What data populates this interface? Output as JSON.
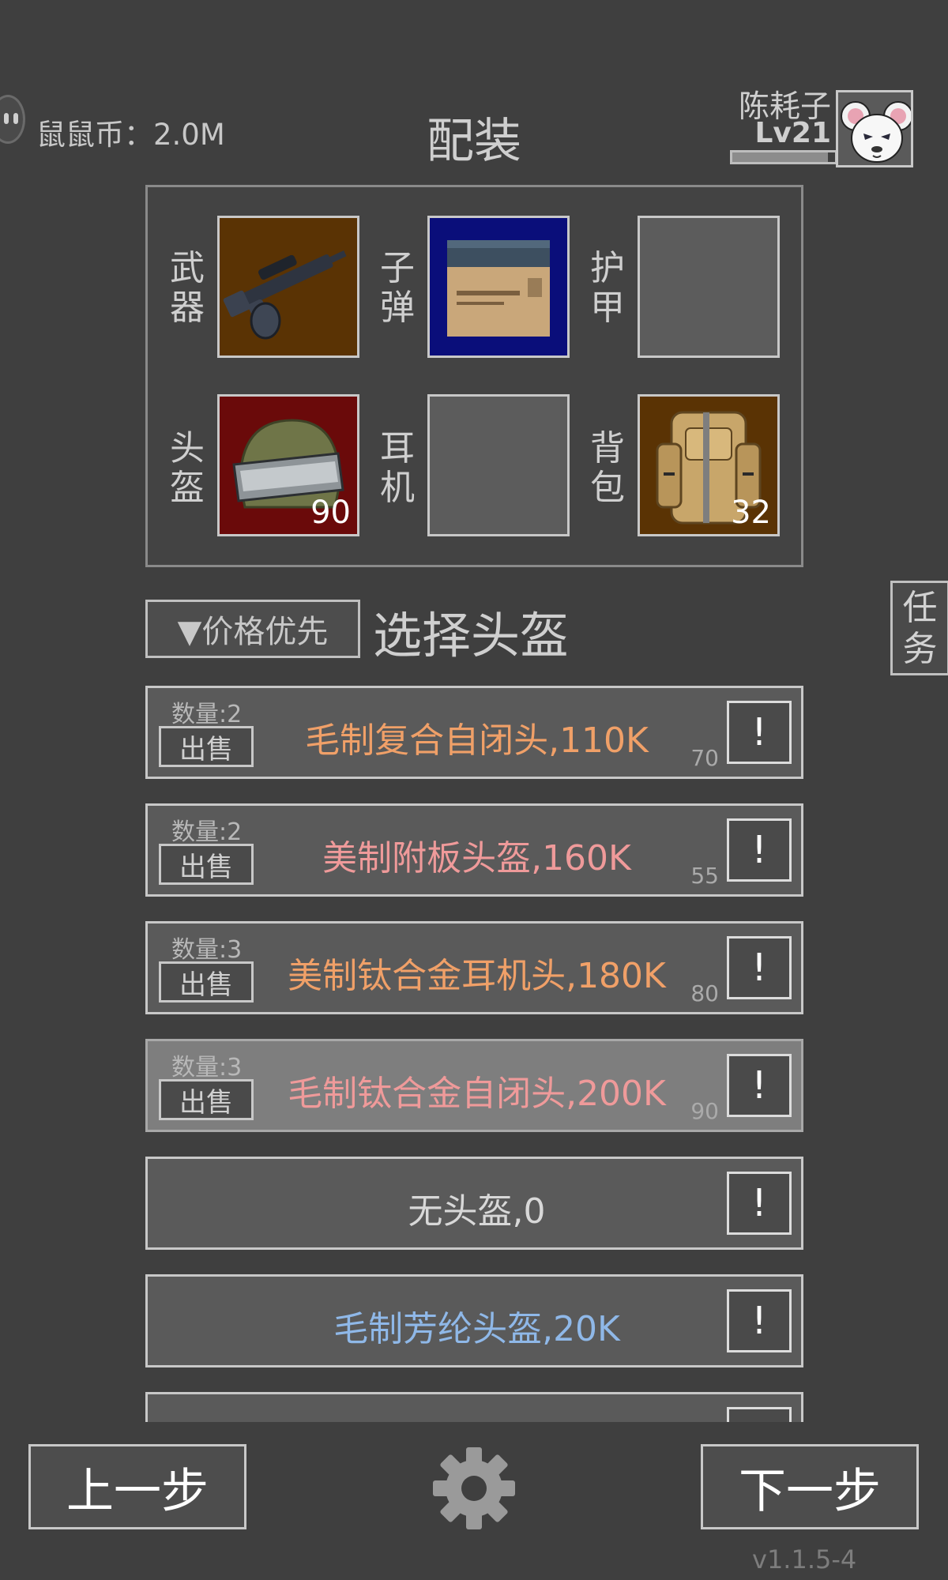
{
  "header": {
    "coin_text": "鼠鼠币：2.0M",
    "title": "配装",
    "user_name": "陈耗子",
    "user_level": "Lv21",
    "xp_fraction": 0.93
  },
  "equipment": {
    "weapon_label": "武器",
    "ammo_label": "子弹",
    "armor_label": "护甲",
    "helmet_label": "头盔",
    "headset_label": "耳机",
    "backpack_label": "背包",
    "helmet_count": "90",
    "backpack_count": "32"
  },
  "selector": {
    "sort_label": "▼价格优先",
    "section_title": "选择头盔",
    "task_label": "任务"
  },
  "items": [
    {
      "qty": "数量:2",
      "sell": "出售",
      "name": "毛制复合自闭头,110K",
      "durability": "70",
      "info": "!",
      "color": "#f0a068"
    },
    {
      "qty": "数量:2",
      "sell": "出售",
      "name": "美制附板头盔,160K",
      "durability": "55",
      "info": "!",
      "color": "#ef9a9a"
    },
    {
      "qty": "数量:3",
      "sell": "出售",
      "name": "美制钛合金耳机头,180K",
      "durability": "80",
      "info": "!",
      "color": "#f0a068"
    },
    {
      "qty": "数量:3",
      "sell": "出售",
      "name": "毛制钛合金自闭头,200K",
      "durability": "90",
      "info": "!",
      "color": "#ef9a9a"
    },
    {
      "name": "无头盔,0",
      "info": "!",
      "color": "#d8d8d8"
    },
    {
      "name": "毛制芳纶头盔,20K",
      "info": "!",
      "color": "#8fb8e8"
    },
    {
      "name": "",
      "info": "!",
      "color": "#d8d8d8"
    }
  ],
  "footer": {
    "prev_label": "上一步",
    "next_label": "下一步",
    "version": "v1.1.5-4"
  },
  "icons": {
    "coin": "mouse-coin-icon",
    "avatar": "white-mouse-avatar",
    "weapon": "machine-gun-icon",
    "ammo": "ammo-box-icon",
    "helmet": "combat-helmet-icon",
    "backpack": "backpack-icon",
    "settings": "gear-icon"
  }
}
